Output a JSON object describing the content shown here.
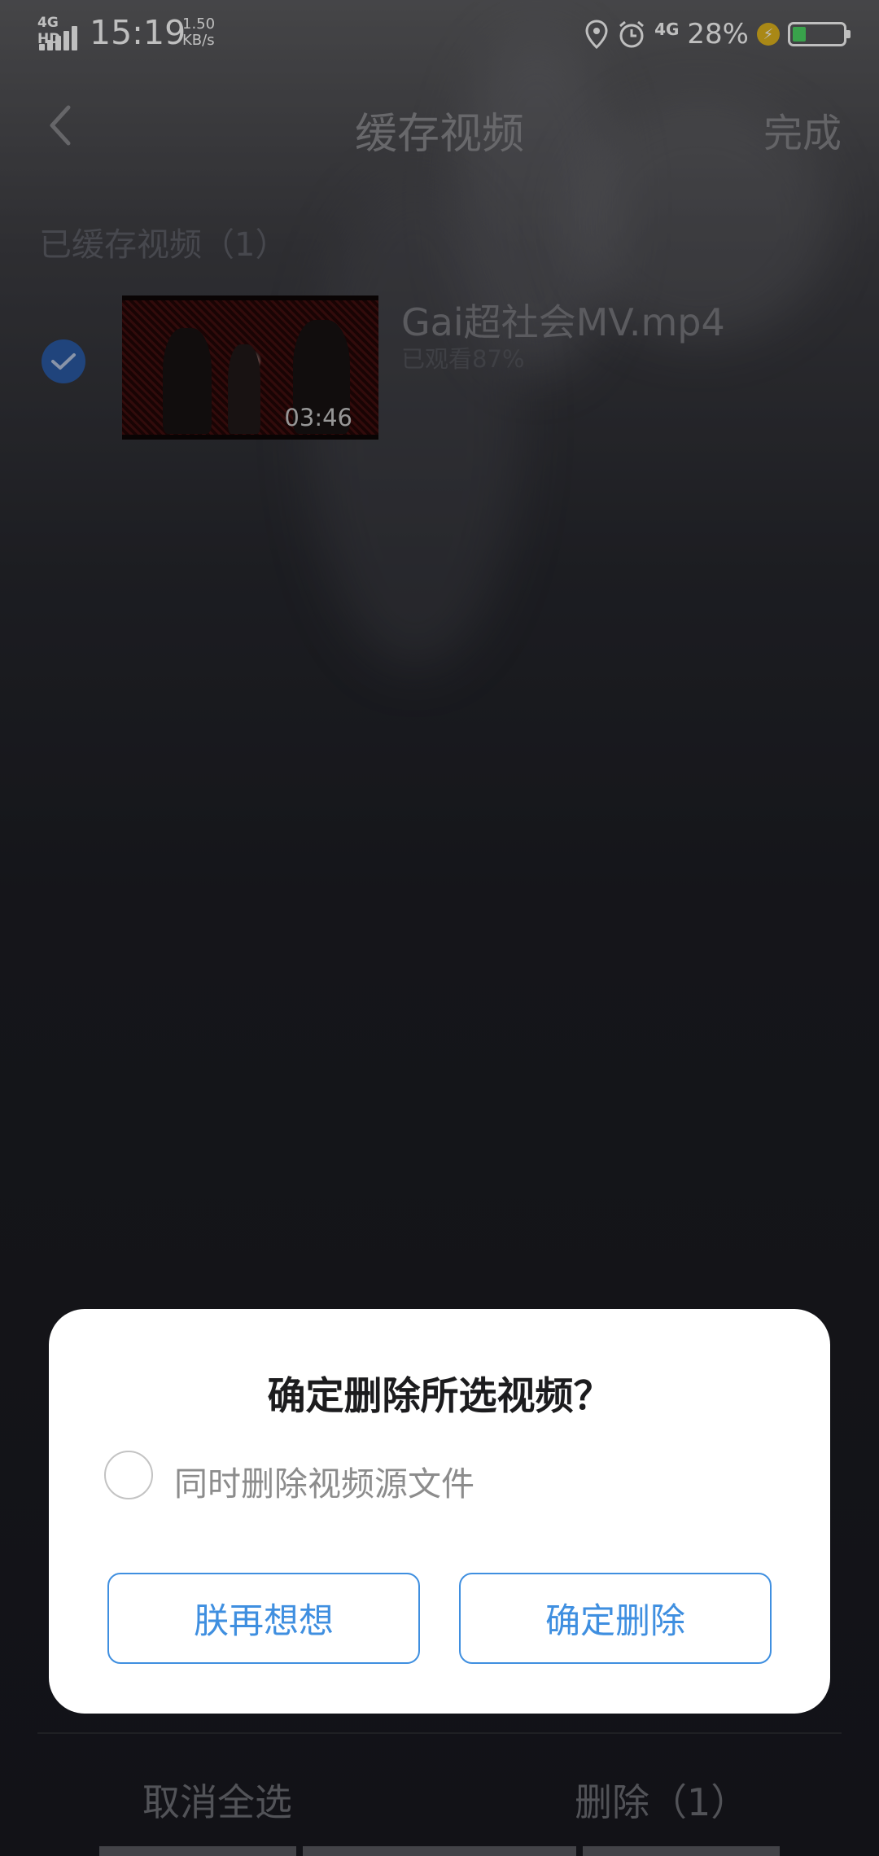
{
  "status_bar": {
    "network": "4G HD",
    "time": "15:19",
    "speed_value": "1.50",
    "speed_unit": "KB/s",
    "data_type": "4G",
    "battery_percent": "28%",
    "icons": [
      "location-icon",
      "alarm-icon",
      "charging-icon",
      "battery-icon"
    ]
  },
  "header": {
    "title": "缓存视频",
    "done_label": "完成"
  },
  "section": {
    "title": "已缓存视频（1）"
  },
  "videos": [
    {
      "name": "Gai超社会MV.mp4",
      "progress": "已观看87%",
      "duration": "03:46",
      "selected": true
    }
  ],
  "bottom_bar": {
    "deselect_all_label": "取消全选",
    "delete_label": "删除（1）"
  },
  "dialog": {
    "title": "确定删除所选视频？",
    "checkbox_label": "同时删除视频源文件",
    "checkbox_checked": false,
    "cancel_label": "朕再想想",
    "confirm_label": "确定删除"
  },
  "colors": {
    "accent": "#3f8fe0",
    "check_blue": "#2b5ba6",
    "battery_green": "#4cd964",
    "charge_yellow": "#e2b61e"
  }
}
